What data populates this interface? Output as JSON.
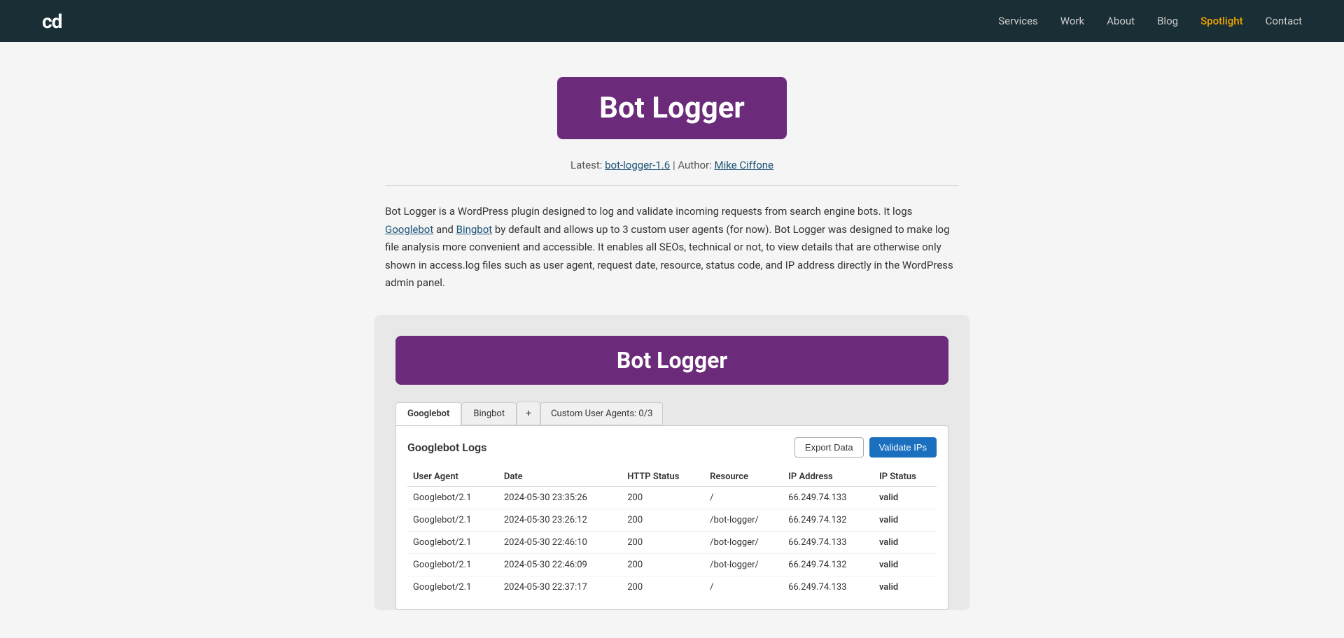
{
  "header": {
    "logo": "cd",
    "nav": [
      {
        "label": "Services",
        "active": false
      },
      {
        "label": "Work",
        "active": false
      },
      {
        "label": "About",
        "active": false
      },
      {
        "label": "Blog",
        "active": false
      },
      {
        "label": "Spotlight",
        "active": true
      },
      {
        "label": "Contact",
        "active": false
      }
    ]
  },
  "hero": {
    "title": "Bot Logger",
    "meta_latest_label": "Latest:",
    "meta_link_text": "bot-logger-1.6",
    "meta_separator": "|",
    "meta_author_label": "Author:",
    "meta_author_link": "Mike Ciffone"
  },
  "description": {
    "text_before_link": "Bot Logger is a WordPress plugin designed to log and validate incoming requests from search engine bots. It logs ",
    "googlebot_link": "Googlebot",
    "text_middle": " and ",
    "bingbot_link": "Bingbot",
    "text_after": " by default and allows up to 3 custom user agents (for now). Bot Logger was designed to make log file analysis more convenient and accessible. It enables all SEOs, technical or not, to view details that are otherwise only shown in access.log files such as user agent, request date, resource, status code, and IP address directly in the WordPress admin panel."
  },
  "demo": {
    "title": "Bot Logger",
    "tabs": [
      {
        "label": "Googlebot",
        "active": true
      },
      {
        "label": "Bingbot",
        "active": false
      },
      {
        "label": "+",
        "type": "plus"
      },
      {
        "label": "Custom User Agents: 0/3",
        "active": false
      }
    ],
    "log_title": "Googlebot Logs",
    "btn_export": "Export Data",
    "btn_validate": "Validate IPs",
    "table": {
      "columns": [
        "User Agent",
        "Date",
        "HTTP Status",
        "Resource",
        "IP Address",
        "IP Status"
      ],
      "rows": [
        {
          "user_agent": "Googlebot/2.1",
          "date": "2024-05-30 23:35:26",
          "http_status": "200",
          "resource": "/",
          "ip_address": "66.249.74.133",
          "ip_status": "valid"
        },
        {
          "user_agent": "Googlebot/2.1",
          "date": "2024-05-30 23:26:12",
          "http_status": "200",
          "resource": "/bot-logger/",
          "ip_address": "66.249.74.132",
          "ip_status": "valid"
        },
        {
          "user_agent": "Googlebot/2.1",
          "date": "2024-05-30 22:46:10",
          "http_status": "200",
          "resource": "/bot-logger/",
          "ip_address": "66.249.74.133",
          "ip_status": "valid"
        },
        {
          "user_agent": "Googlebot/2.1",
          "date": "2024-05-30 22:46:09",
          "http_status": "200",
          "resource": "/bot-logger/",
          "ip_address": "66.249.74.132",
          "ip_status": "valid"
        },
        {
          "user_agent": "Googlebot/2.1",
          "date": "2024-05-30 22:37:17",
          "http_status": "200",
          "resource": "/",
          "ip_address": "66.249.74.133",
          "ip_status": "valid"
        }
      ]
    }
  }
}
